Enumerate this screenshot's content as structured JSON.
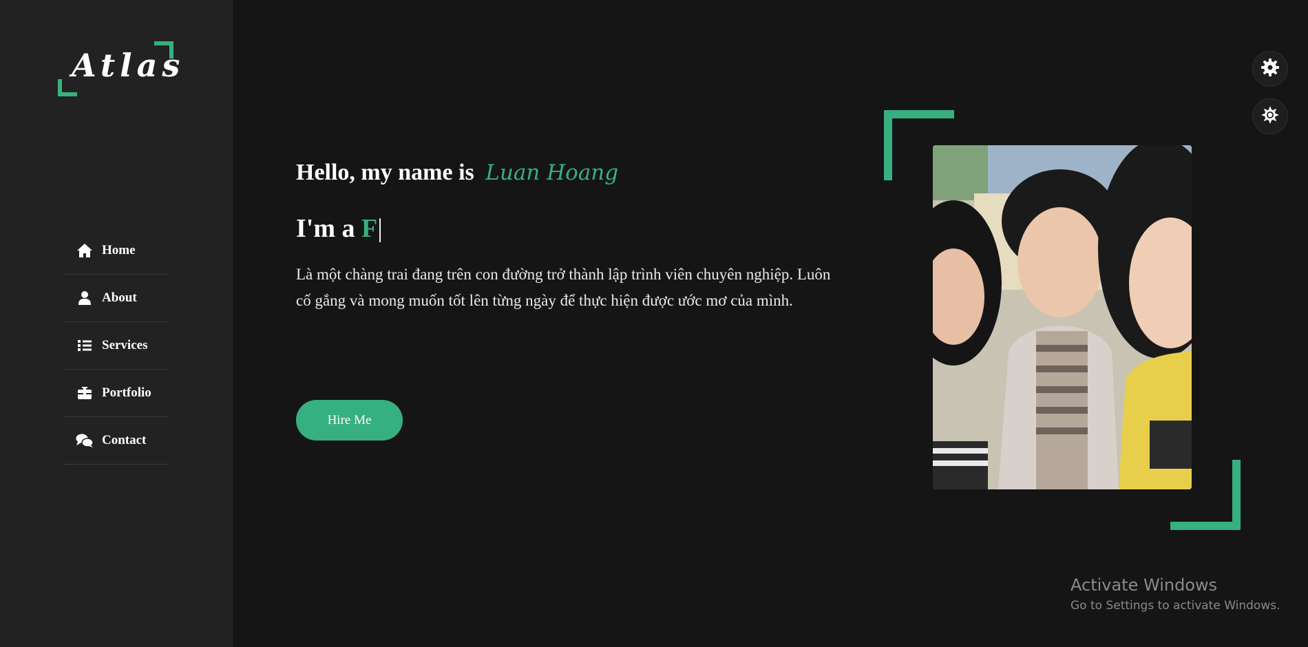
{
  "brand": {
    "logo_text": "Atlas",
    "accent_color": "#37b07f"
  },
  "sidebar": {
    "items": [
      {
        "label": "Home",
        "icon": "home-icon"
      },
      {
        "label": "About",
        "icon": "user-icon"
      },
      {
        "label": "Services",
        "icon": "list-icon"
      },
      {
        "label": "Portfolio",
        "icon": "briefcase-icon"
      },
      {
        "label": "Contact",
        "icon": "comments-icon"
      }
    ]
  },
  "hero": {
    "greeting": "Hello, my name is",
    "name": "Luan Hoang",
    "role_prefix": "I'm a",
    "role_typed": "F",
    "caret": "|",
    "bio": "Là một chàng trai đang trên con đường trở thành lập trình viên chuyên nghiệp. Luôn cố gắng và mong muốn tốt lên từng ngày để thực hiện được ước mơ của mình.",
    "cta_label": "Hire Me"
  },
  "photo": {
    "subject": "profile-photo"
  },
  "floating_buttons": [
    {
      "icon": "gear-icon"
    },
    {
      "icon": "sun-icon"
    }
  ],
  "watermark": {
    "title": "Activate Windows",
    "subtitle": "Go to Settings to activate Windows."
  }
}
